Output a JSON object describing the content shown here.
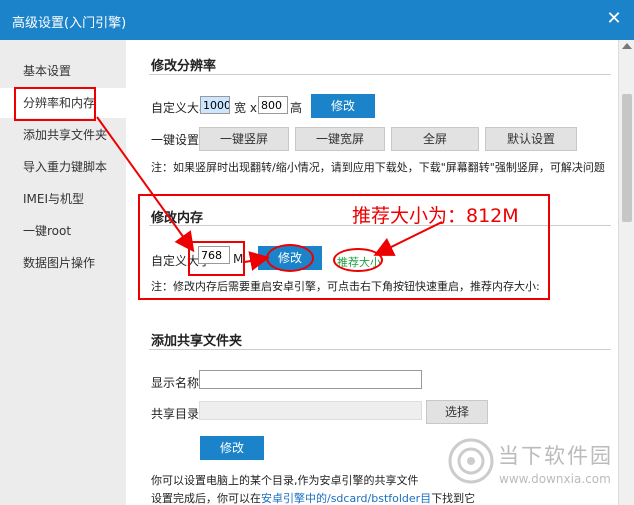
{
  "window": {
    "title": "高级设置(入门引擎)"
  },
  "sidebar": {
    "items": [
      {
        "label": "基本设置"
      },
      {
        "label": "分辨率和内存"
      },
      {
        "label": "添加共享文件夹"
      },
      {
        "label": "导入重力键脚本"
      },
      {
        "label": "IMEI与机型"
      },
      {
        "label": "一键root"
      },
      {
        "label": "数据图片操作"
      }
    ]
  },
  "resolution": {
    "title": "修改分辨率",
    "custom_label": "自定义大小:",
    "width_value": "1000",
    "width_label": "宽 x",
    "height_value": "800",
    "height_label": "高",
    "modify_label": "修改",
    "quick_label": "一键设置:",
    "portrait_label": "一键竖屏",
    "landscape_label": "一键宽屏",
    "fullscreen_label": "全屏",
    "default_label": "默认设置",
    "note": "注：如果竖屏时出现翻转/缩小情况，请到应用下载处，下载\"屏幕翻转\"强制竖屏，可解决问题"
  },
  "memory": {
    "title": "修改内存",
    "custom_label": "自定义大小",
    "value": "768",
    "unit": "M",
    "modify_label": "修改",
    "recommend_label": "推荐大小",
    "note": "注：修改内存后需要重启安卓引擎，可点击右下角按钮快速重启，推荐内存大小:",
    "annotation": "推荐大小为：812M"
  },
  "shared_folder": {
    "title": "添加共享文件夹",
    "display_name_label": "显示名称:",
    "display_name_value": "",
    "directory_label": "共享目录:",
    "directory_value": "",
    "browse_label": "选择",
    "modify_label": "修改",
    "info_line1": "你可以设置电脑上的某个目录,作为安卓引擎的共享文件",
    "info_line2_prefix": "设置完成后，你可以在",
    "info_line2_link": "安卓引擎中的/sdcard/bstfolder目",
    "info_line2_suffix": "下找到它"
  },
  "watermark": {
    "name": "当下软件园",
    "url": "www.downxia.com"
  },
  "colors": {
    "accent": "#1a83c9",
    "annotation": "#e00000",
    "sidebar_bg": "#ececec"
  }
}
